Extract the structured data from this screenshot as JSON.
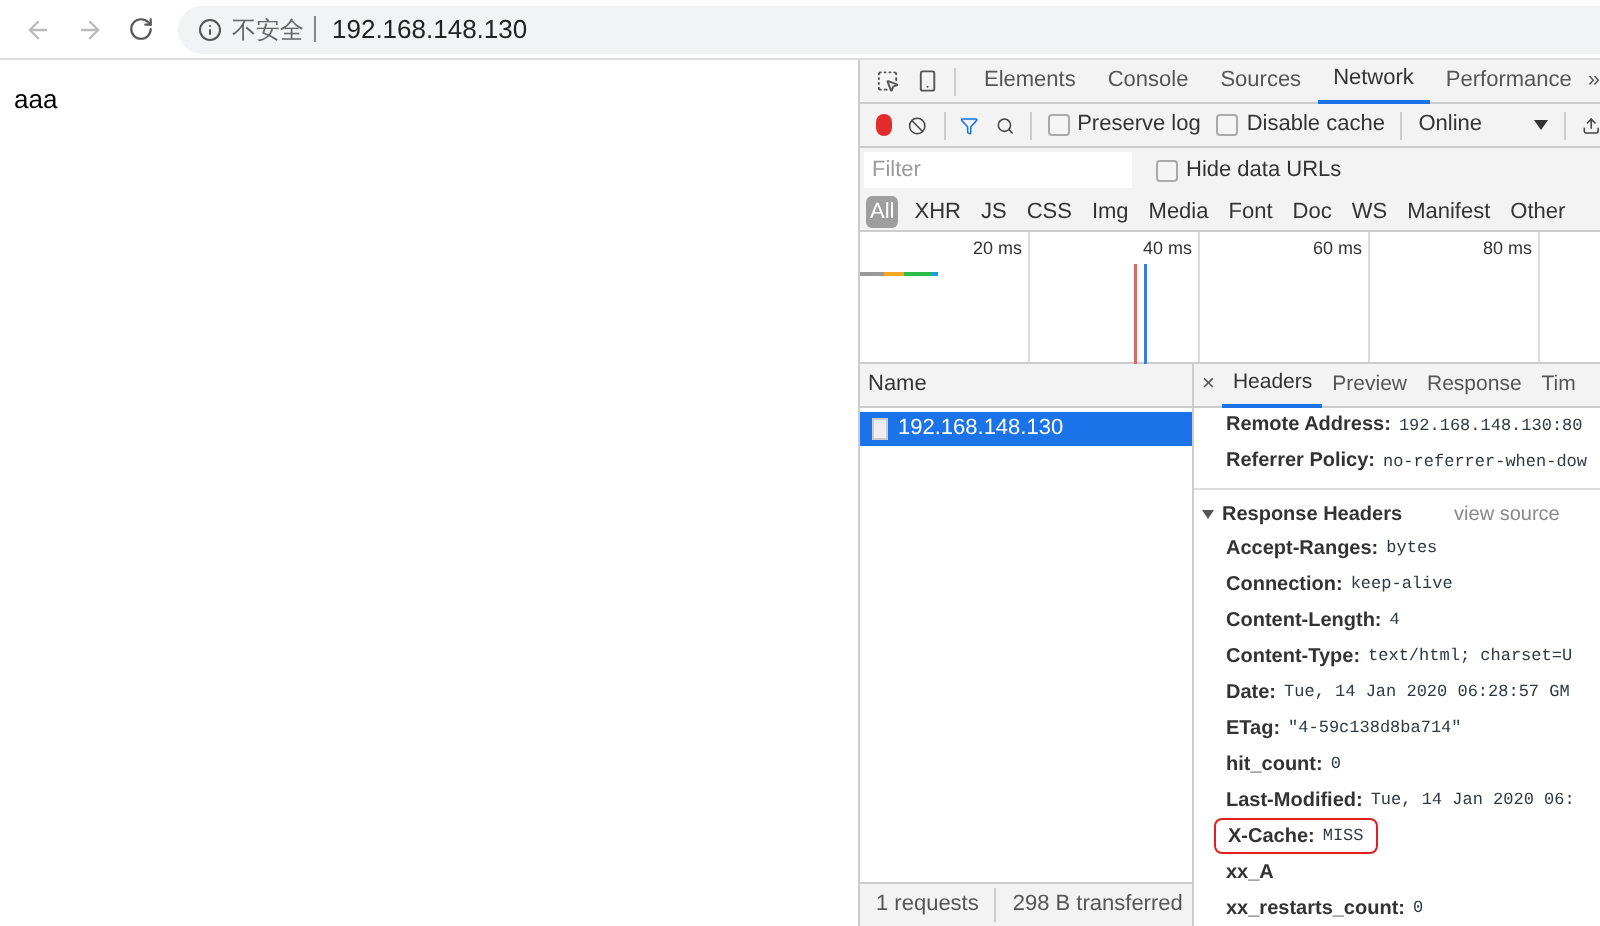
{
  "browser": {
    "security_label": "不安全",
    "url": "192.168.148.130"
  },
  "page": {
    "text": "aaa"
  },
  "devtools": {
    "tabs": [
      {
        "label": "Elements",
        "selected": false
      },
      {
        "label": "Console",
        "selected": false
      },
      {
        "label": "Sources",
        "selected": false
      },
      {
        "label": "Network",
        "selected": true
      },
      {
        "label": "Performance",
        "selected": false
      }
    ],
    "more_tabs": "»",
    "toolbar": {
      "recording": true,
      "filter_active": true,
      "preserve_log": {
        "label": "Preserve log",
        "checked": false
      },
      "disable_cache": {
        "label": "Disable cache",
        "checked": false
      },
      "throttling": "Online"
    },
    "filter": {
      "placeholder": "Filter",
      "hide_data_urls": {
        "label": "Hide data URLs",
        "checked": false
      }
    },
    "types": [
      {
        "label": "All",
        "selected": true
      },
      {
        "label": "XHR",
        "selected": false
      },
      {
        "label": "JS",
        "selected": false
      },
      {
        "label": "CSS",
        "selected": false
      },
      {
        "label": "Img",
        "selected": false
      },
      {
        "label": "Media",
        "selected": false
      },
      {
        "label": "Font",
        "selected": false
      },
      {
        "label": "Doc",
        "selected": false
      },
      {
        "label": "WS",
        "selected": false
      },
      {
        "label": "Manifest",
        "selected": false
      },
      {
        "label": "Other",
        "selected": false
      }
    ],
    "timeline": {
      "ticks": [
        "20 ms",
        "40 ms",
        "60 ms",
        "80 ms"
      ]
    },
    "requests": {
      "column": "Name",
      "rows": [
        {
          "name": "192.168.148.130",
          "selected": true
        }
      ]
    },
    "status_bar": [
      "1 requests",
      "298 B transferred"
    ],
    "detail": {
      "close": "×",
      "tabs": [
        {
          "label": "Headers",
          "selected": true
        },
        {
          "label": "Preview",
          "selected": false
        },
        {
          "label": "Response",
          "selected": false
        },
        {
          "label": "Tim",
          "selected": false
        }
      ],
      "general": [
        {
          "name": "Remote Address:",
          "value": "192.168.148.130:80",
          "highlighted": false
        },
        {
          "name": "Referrer Policy:",
          "value": "no-referrer-when-dow",
          "highlighted": false
        }
      ],
      "response_headers": {
        "title": "Response Headers",
        "expanded": true,
        "link": "view source",
        "headers": [
          {
            "name": "Accept-Ranges:",
            "value": "bytes",
            "highlighted": false
          },
          {
            "name": "Connection:",
            "value": "keep-alive",
            "highlighted": false
          },
          {
            "name": "Content-Length:",
            "value": "4",
            "highlighted": false
          },
          {
            "name": "Content-Type:",
            "value": "text/html; charset=U",
            "highlighted": false
          },
          {
            "name": "Date:",
            "value": "Tue, 14 Jan 2020 06:28:57 GM",
            "highlighted": false
          },
          {
            "name": "ETag:",
            "value": "\"4-59c138d8ba714\"",
            "highlighted": false
          },
          {
            "name": "hit_count:",
            "value": "0",
            "highlighted": false
          },
          {
            "name": "Last-Modified:",
            "value": "Tue, 14 Jan 2020 06:",
            "highlighted": false
          },
          {
            "name": "X-Cache:",
            "value": "MISS",
            "highlighted": true
          },
          {
            "name": "xx_A",
            "highlighted": false
          },
          {
            "name": "xx_restarts_count:",
            "value": "0",
            "highlighted": false
          }
        ]
      }
    }
  }
}
